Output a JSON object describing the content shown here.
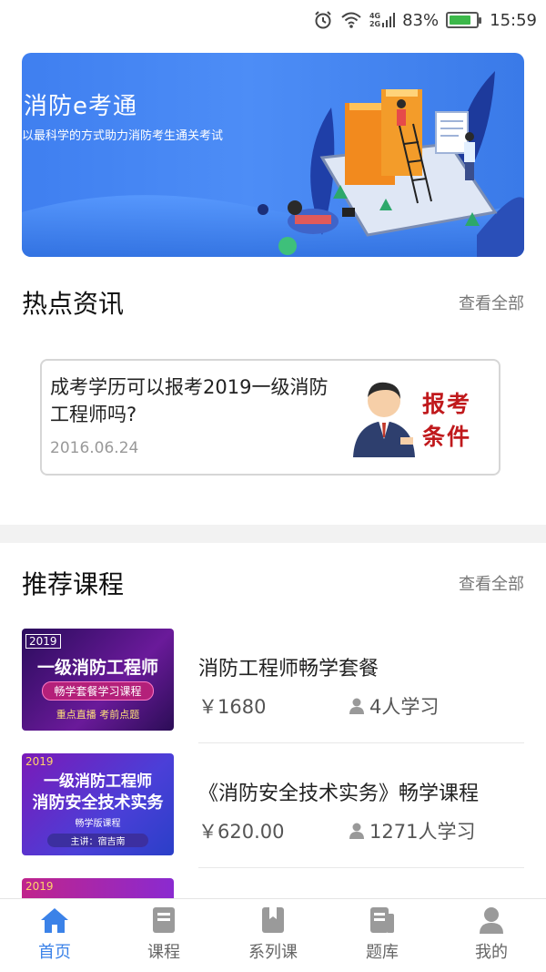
{
  "status_bar": {
    "signal_label_top": "4G",
    "signal_label_bottom": "2G",
    "battery": "83%",
    "battery_level": 0.83,
    "time": "15:59",
    "icons": [
      "alarm-icon",
      "wifi-icon",
      "cell-signal-icon",
      "battery-icon"
    ]
  },
  "banner": {
    "title": "消防e考通",
    "subtitle": "以最科学的方式助力消防考生通关考试"
  },
  "hot_news": {
    "title": "热点资讯",
    "more": "查看全部",
    "items": [
      {
        "title": "成考学历可以报考2019一级消防工程师吗?",
        "date": "2016.06.24",
        "thumb_text_line1": "报考",
        "thumb_text_line2": "条件"
      }
    ]
  },
  "recommended": {
    "title": "推荐课程",
    "more": "查看全部",
    "courses": [
      {
        "name": "消防工程师畅学套餐",
        "price": "￥1680",
        "learners": "4人学习",
        "thumb_year": "2019",
        "thumb_line1": "一级消防工程师",
        "thumb_line2": "畅学套餐学习课程",
        "thumb_line3": "重点直播  考前点题"
      },
      {
        "name": "《消防安全技术实务》畅学课程",
        "price": "￥620.00",
        "learners": "1271人学习",
        "thumb_year": "2019",
        "thumb_line1": "一级消防工程师",
        "thumb_line2": "消防安全技术实务",
        "thumb_line3": "畅学版课程",
        "thumb_line4": "主讲：宿吉南"
      },
      {
        "thumb_year": "2019"
      }
    ]
  },
  "tab_bar": {
    "tabs": [
      {
        "label": "首页",
        "icon": "home-icon",
        "active": true
      },
      {
        "label": "课程",
        "icon": "book-icon",
        "active": false
      },
      {
        "label": "系列课",
        "icon": "bookmark-icon",
        "active": false
      },
      {
        "label": "题库",
        "icon": "question-bank-icon",
        "active": false
      },
      {
        "label": "我的",
        "icon": "user-icon",
        "active": false
      }
    ]
  },
  "colors": {
    "accent": "#3b82e8",
    "price_text": "#555555",
    "banner_bg": "#4a89f3"
  }
}
